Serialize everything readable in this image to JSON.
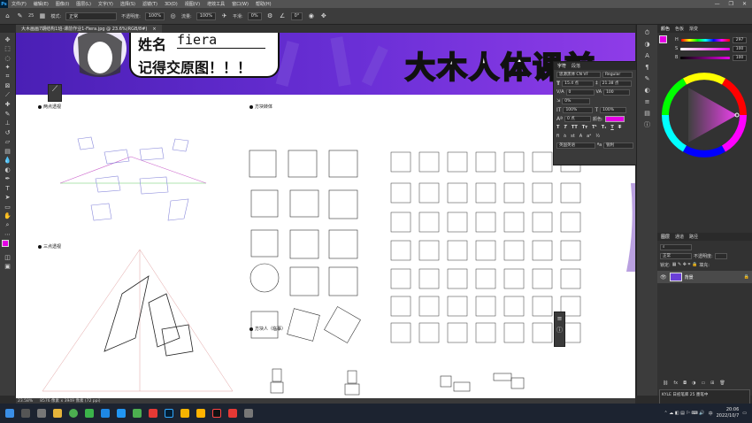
{
  "menubar": {
    "logo": "Ps",
    "items": [
      "文件(F)",
      "编辑(E)",
      "图像(I)",
      "图层(L)",
      "文字(Y)",
      "选择(S)",
      "滤镜(T)",
      "3D(D)",
      "视图(V)",
      "增效工具",
      "窗口(W)",
      "帮助(H)"
    ],
    "window_controls": [
      "—",
      "❐",
      "✕"
    ]
  },
  "options_bar": {
    "mode_label": "模式:",
    "mode_value": "正常",
    "opacity_label": "不透明度:",
    "opacity_value": "100%",
    "flow_label": "流量:",
    "flow_value": "100%",
    "smooth_label": "平滑:",
    "smooth_value": "0%",
    "angle_value": "0°",
    "brush_size": "25"
  },
  "document": {
    "tab_title": "大木画画7期结构1班-课前作业1-Fiera.jpg @ 23.6%(RGB/8#)",
    "tab_close": "×"
  },
  "canvas_content": {
    "name_label": "姓名",
    "name_value": "fiera",
    "reminder": "记得交原图！！！",
    "banner_title": "大木人体课前",
    "section_two_point": "两点透视",
    "section_three_point": "三点透视",
    "section_box": "方块转体",
    "section_box_people": "方块人（临摹）"
  },
  "character_panel": {
    "tabs": [
      "字符",
      "段落"
    ],
    "font_family": "思源黑体 CN VF",
    "font_style": "Regular",
    "font_size": "15.4 点",
    "leading": "21.38 点",
    "kerning": "0",
    "tracking": "100",
    "scale_pct": "0%",
    "vscale": "100%",
    "hscale": "100%",
    "baseline": "0 点",
    "color_label": "颜色:",
    "language": "英国英语",
    "antialias": "锐利",
    "color_hex": "#e600e6"
  },
  "color_panel": {
    "tabs": [
      "颜色",
      "色板",
      "渐变"
    ],
    "h_label": "H",
    "s_label": "S",
    "b_label": "B",
    "h_value": "297",
    "s_value": "100",
    "b_value": "100"
  },
  "layers_panel": {
    "tabs": [
      "图层",
      "通道",
      "路径"
    ],
    "mode": "正常",
    "opacity_label": "不透明度:",
    "lock_label": "锁定:",
    "fill_label": "填充:",
    "layer_name": "背景",
    "history_note": "KYLE 日初笔库 25 墨笔中"
  },
  "status_bar": {
    "zoom": "23.58%",
    "doc_info": "8576 像素 x 3949 像素 (72 ppi)"
  },
  "taskbar": {
    "time": "20:06",
    "date": "2022/10/7",
    "lang": "中"
  },
  "colors": {
    "foreground": "#e600e6",
    "background": "#ffffff",
    "banner_start": "#4a1fb5",
    "banner_end": "#8f3ce8"
  }
}
